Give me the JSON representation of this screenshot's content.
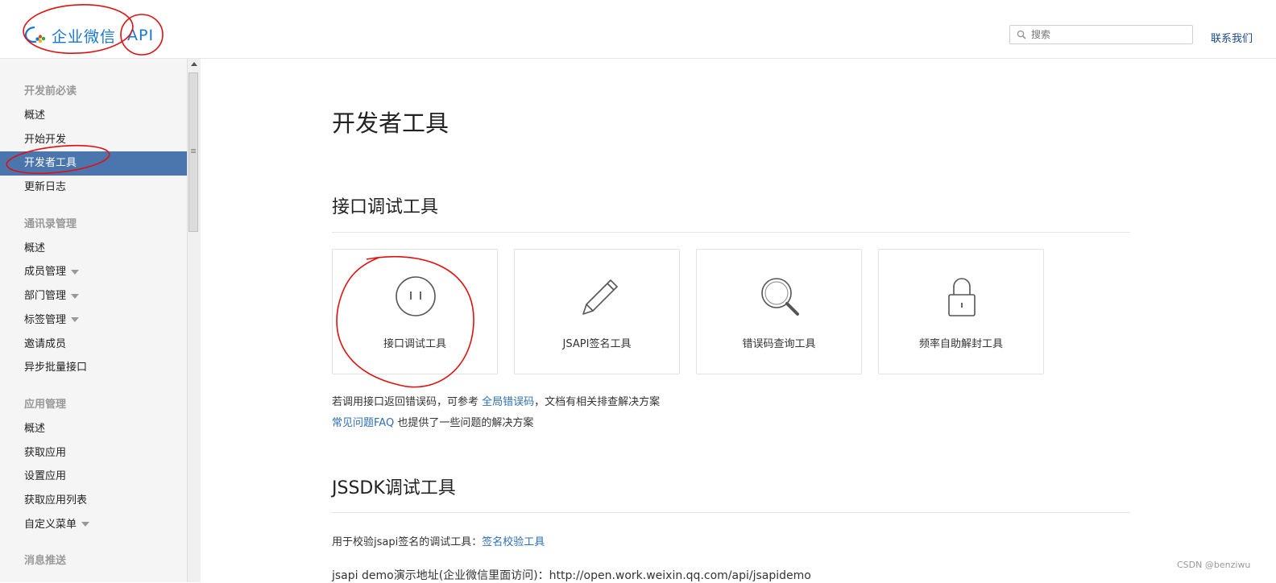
{
  "header": {
    "logo_text": "企业微信",
    "logo_api": "API",
    "search_placeholder": "搜索",
    "contact": "联系我们"
  },
  "sidebar": {
    "groups": [
      {
        "title": "开发前必读",
        "items": [
          {
            "label": "概述"
          },
          {
            "label": "开始开发"
          },
          {
            "label": "开发者工具",
            "active": true
          },
          {
            "label": "更新日志"
          }
        ]
      },
      {
        "title": "通讯录管理",
        "items": [
          {
            "label": "概述"
          },
          {
            "label": "成员管理",
            "caret": true
          },
          {
            "label": "部门管理",
            "caret": true
          },
          {
            "label": "标签管理",
            "caret": true
          },
          {
            "label": "邀请成员"
          },
          {
            "label": "异步批量接口"
          }
        ]
      },
      {
        "title": "应用管理",
        "items": [
          {
            "label": "概述"
          },
          {
            "label": "获取应用"
          },
          {
            "label": "设置应用"
          },
          {
            "label": "获取应用列表"
          },
          {
            "label": "自定义菜单",
            "caret": true
          }
        ]
      },
      {
        "title": "消息推送",
        "items": []
      }
    ]
  },
  "main": {
    "page_title": "开发者工具",
    "section1": {
      "title": "接口调试工具",
      "cards": [
        {
          "label": "接口调试工具",
          "icon": "plug-icon"
        },
        {
          "label": "JSAPI签名工具",
          "icon": "pencil-icon"
        },
        {
          "label": "错误码查询工具",
          "icon": "magnifier-icon"
        },
        {
          "label": "频率自助解封工具",
          "icon": "lock-icon"
        }
      ],
      "note1_pre": "若调用接口返回错误码，可参考",
      "note1_link": "全局错误码",
      "note1_post": "，文档有相关排查解决方案",
      "note2_link": "常见问题FAQ",
      "note2_post": "也提供了一些问题的解决方案"
    },
    "section2": {
      "title": "JSSDK调试工具",
      "line1_pre": "用于校验jsapi签名的调试工具：",
      "line1_link": "签名校验工具",
      "line2": "jsapi demo演示地址(企业微信里面访问)：http://open.work.weixin.qq.com/api/jsapidemo"
    }
  },
  "watermark": "CSDN @benziwu",
  "colors": {
    "accent": "#1976d2",
    "active_bg": "#4a76ad",
    "link": "#2f6fb5",
    "annotation": "#e01010"
  }
}
